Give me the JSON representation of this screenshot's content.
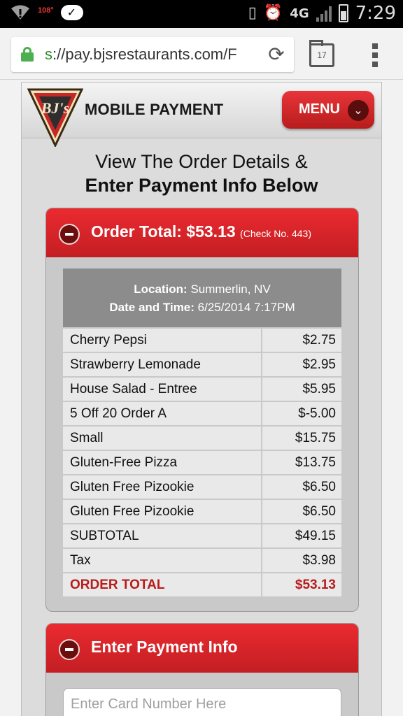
{
  "status_bar": {
    "temperature": "108°",
    "network": "4G",
    "time": "7:29"
  },
  "browser": {
    "url_scheme": "s",
    "url_rest": "://pay.bjsrestaurants.com/F",
    "tab_count": "17"
  },
  "header": {
    "logo_text": "BJ's",
    "title": "MOBILE PAYMENT",
    "menu_label": "MENU"
  },
  "intro": {
    "line1": "View The Order Details &",
    "line2": "Enter Payment Info Below"
  },
  "order_panel": {
    "title": "Order Total: $53.13",
    "check_no": "(Check No. 443)",
    "location_label": "Location:",
    "location_value": "Summerlin, NV",
    "datetime_label": "Date and Time:",
    "datetime_value": "6/25/2014 7:17PM",
    "items": [
      {
        "name": "Cherry Pepsi",
        "price": "$2.75"
      },
      {
        "name": "Strawberry Lemonade",
        "price": "$2.95"
      },
      {
        "name": "House Salad - Entree",
        "price": "$5.95"
      },
      {
        "name": "5 Off 20 Order A",
        "price": "$-5.00"
      },
      {
        "name": "Small",
        "price": "$15.75"
      },
      {
        "name": "Gluten-Free Pizza",
        "price": "$13.75"
      },
      {
        "name": "Gluten Free Pizookie",
        "price": "$6.50"
      },
      {
        "name": "Gluten Free Pizookie",
        "price": "$6.50"
      },
      {
        "name": "SUBTOTAL",
        "price": "$49.15"
      },
      {
        "name": "Tax",
        "price": "$3.98"
      },
      {
        "name": "ORDER TOTAL",
        "price": "$53.13"
      }
    ]
  },
  "payment_panel": {
    "title": "Enter Payment Info",
    "card_placeholder": "Enter Card Number Here"
  },
  "colors": {
    "brand_red": "#e0262b",
    "total_red": "#b71c1c"
  }
}
